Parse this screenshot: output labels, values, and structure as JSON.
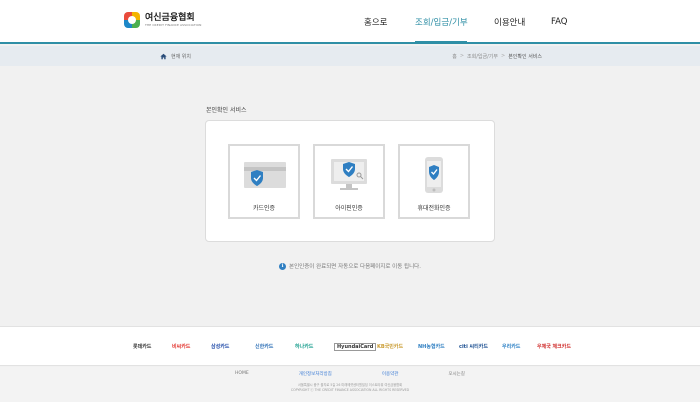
{
  "header": {
    "logo_name": "여신금융협회",
    "logo_sub": "THE CREDIT FINANCE ASSOCIATION",
    "nav": [
      "홈으로",
      "조회/입금/기부",
      "이용안내",
      "FAQ"
    ]
  },
  "location": {
    "label": "현재 위치",
    "breadcrumb": [
      "홈",
      "조회/입금/기부",
      "본인확인 서비스"
    ]
  },
  "main": {
    "section_title": "본인확인 서비스",
    "cards": [
      {
        "label": "카드인증",
        "icon": "card-shield-icon"
      },
      {
        "label": "아이핀인증",
        "icon": "monitor-shield-icon"
      },
      {
        "label": "휴대전화인증",
        "icon": "phone-shield-icon"
      }
    ],
    "notice": "본인인증이 완료되면 자동으로 다음페이지로 이동 됩니다."
  },
  "partners": [
    {
      "name": "롯데카드",
      "color": "#333333"
    },
    {
      "name": "비씨카드",
      "color": "#e2312b"
    },
    {
      "name": "삼성카드",
      "color": "#1f4aa8"
    },
    {
      "name": "신한카드",
      "color": "#2a6db5"
    },
    {
      "name": "하나카드",
      "color": "#1a9e8e"
    },
    {
      "name": "HyundaiCard",
      "color": "#333333"
    },
    {
      "name": "KB국민카드",
      "color": "#c99a2e"
    },
    {
      "name": "NH농협카드",
      "color": "#2f7fc2"
    },
    {
      "name": "citi 씨티카드",
      "color": "#1b4f91"
    },
    {
      "name": "우리카드",
      "color": "#2a7fc4"
    },
    {
      "name": "우체국 체크카드",
      "color": "#d0302f"
    }
  ],
  "footer": {
    "links": [
      "HOME",
      "개인정보처리방침",
      "이용약관",
      "오시는길"
    ],
    "address": "서울특별시 중구 을지로 5길 26 미래에셋센터원빌딩 이스트타워 여신금융협회",
    "copyright": "COPYRIGHT ⓒ THE CREDIT FINANCE ASSOCIATION ALL RIGHTS RESERVED"
  },
  "colors": {
    "accent": "#2f8fa6",
    "shield": "#2f7fc2",
    "background": "#f1f1f1"
  }
}
